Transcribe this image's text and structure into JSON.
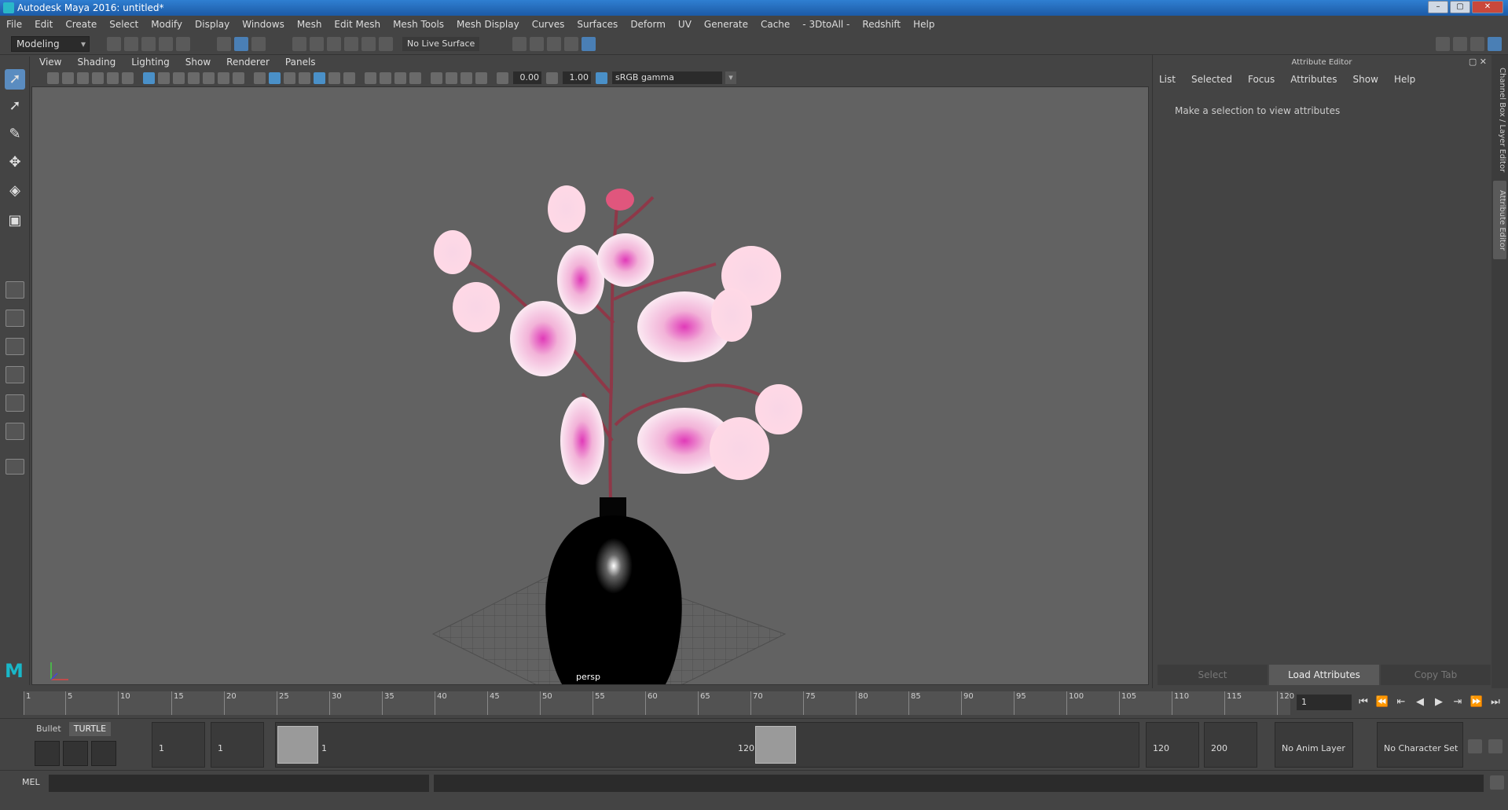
{
  "window": {
    "title": "Autodesk Maya 2016: untitled*",
    "min": "–",
    "max": "▢",
    "close": "✕"
  },
  "menubar": [
    "File",
    "Edit",
    "Create",
    "Select",
    "Modify",
    "Display",
    "Windows",
    "Mesh",
    "Edit Mesh",
    "Mesh Tools",
    "Mesh Display",
    "Curves",
    "Surfaces",
    "Deform",
    "UV",
    "Generate",
    "Cache",
    "- 3DtoAll -",
    "Redshift",
    "Help"
  ],
  "shelf": {
    "mode": "Modeling",
    "live_surface": "No Live Surface"
  },
  "viewport": {
    "menu": [
      "View",
      "Shading",
      "Lighting",
      "Show",
      "Renderer",
      "Panels"
    ],
    "exposure": "0.00",
    "gamma_value": "1.00",
    "color_space": "sRGB gamma",
    "camera": "persp"
  },
  "attribute_editor": {
    "title": "Attribute Editor",
    "menu": [
      "List",
      "Selected",
      "Focus",
      "Attributes",
      "Show",
      "Help"
    ],
    "message": "Make a selection to view attributes",
    "buttons": {
      "select": "Select",
      "load": "Load Attributes",
      "copy": "Copy Tab"
    }
  },
  "side_tabs": {
    "channel_box": "Channel Box / Layer Editor",
    "attribute_editor": "Attribute Editor"
  },
  "timeline": {
    "ticks": [
      "1",
      "5",
      "10",
      "15",
      "20",
      "25",
      "30",
      "35",
      "40",
      "45",
      "50",
      "55",
      "60",
      "65",
      "70",
      "75",
      "80",
      "85",
      "90",
      "95",
      "100",
      "105",
      "110",
      "115",
      "120"
    ],
    "current_frame": "1"
  },
  "range": {
    "shelf_tabs": [
      "Bullet",
      "TURTLE"
    ],
    "start_outer": "1",
    "start_inner": "1",
    "slider_start": "1",
    "slider_end": "120",
    "end_inner": "120",
    "end_outer": "200",
    "anim_layer": "No Anim Layer",
    "char_set": "No Character Set"
  },
  "command_line": {
    "label": "MEL"
  }
}
